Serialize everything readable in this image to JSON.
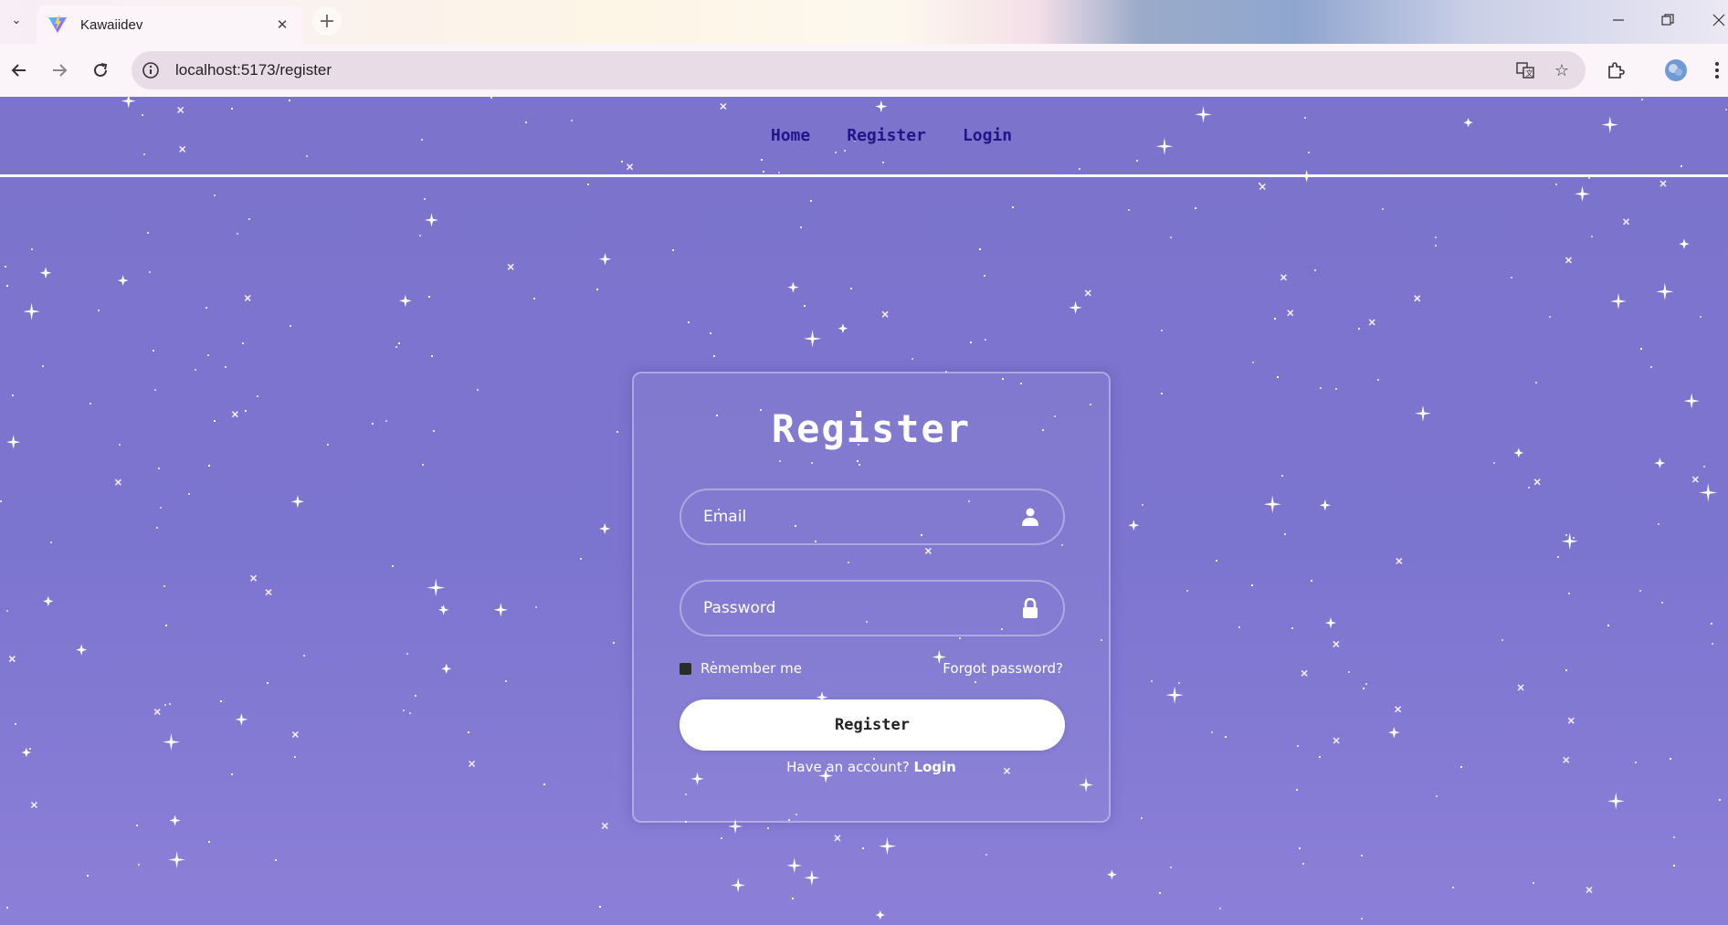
{
  "browser": {
    "tab_title": "Kawaiidev",
    "new_tab_icon": "plus-icon",
    "url": "localhost:5173/register",
    "window_controls": [
      "minimize-icon",
      "restore-icon",
      "close-icon"
    ]
  },
  "nav": {
    "links": [
      {
        "label": "Home"
      },
      {
        "label": "Register"
      },
      {
        "label": "Login"
      }
    ]
  },
  "form": {
    "title": "Register",
    "email_placeholder": "Email",
    "password_placeholder": "Password",
    "remember_label": "Remember me",
    "forgot_label": "Forgot password?",
    "submit_label": "Register",
    "account_prefix": "Have an account?",
    "login_link": "Login"
  },
  "colors": {
    "background": "#7b74cc",
    "nav_link": "#24148a",
    "card_border": "#ffffff",
    "button": "#ffffff"
  }
}
